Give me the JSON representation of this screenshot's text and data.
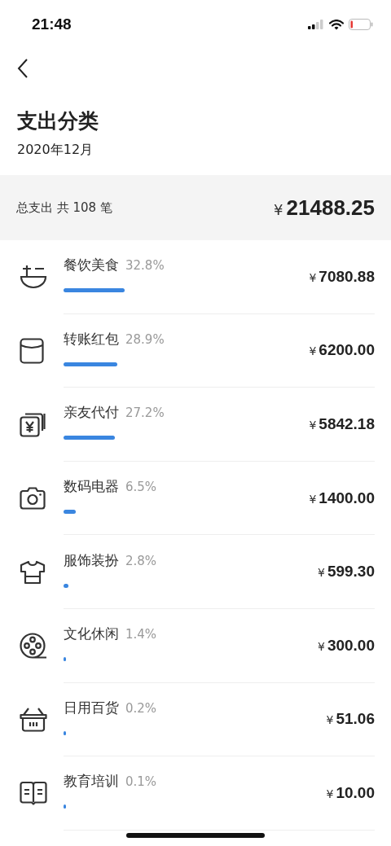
{
  "status_bar": {
    "time": "21:48"
  },
  "title": "支出分类",
  "subtitle": "2020年12月",
  "summary": {
    "label": "总支出 共 108 笔",
    "currency": "¥",
    "total": "21488.25"
  },
  "categories": [
    {
      "name": "餐饮美食",
      "percent": "32.8%",
      "currency": "¥",
      "amount": "7080.88"
    },
    {
      "name": "转账红包",
      "percent": "28.9%",
      "currency": "¥",
      "amount": "6200.00"
    },
    {
      "name": "亲友代付",
      "percent": "27.2%",
      "currency": "¥",
      "amount": "5842.18"
    },
    {
      "name": "数码电器",
      "percent": "6.5%",
      "currency": "¥",
      "amount": "1400.00"
    },
    {
      "name": "服饰装扮",
      "percent": "2.8%",
      "currency": "¥",
      "amount": "599.30"
    },
    {
      "name": "文化休闲",
      "percent": "1.4%",
      "currency": "¥",
      "amount": "300.00"
    },
    {
      "name": "日用百货",
      "percent": "0.2%",
      "currency": "¥",
      "amount": "51.06"
    },
    {
      "name": "教育培训",
      "percent": "0.1%",
      "currency": "¥",
      "amount": "10.00"
    }
  ]
}
